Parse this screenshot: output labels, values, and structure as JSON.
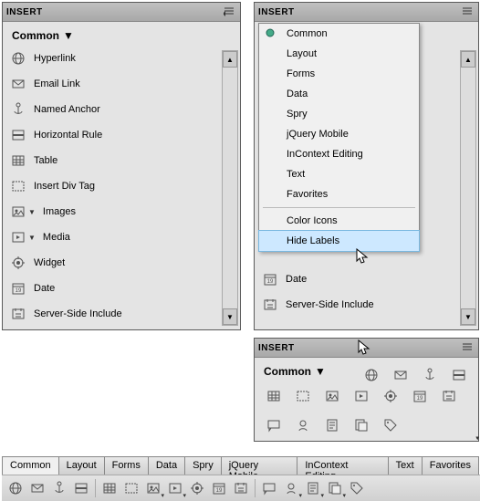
{
  "panel_title": "INSERT",
  "category": "Common",
  "left_panel": {
    "items": [
      {
        "label": "Hyperlink",
        "icon": "hyperlink"
      },
      {
        "label": "Email Link",
        "icon": "email"
      },
      {
        "label": "Named Anchor",
        "icon": "anchor"
      },
      {
        "label": "Horizontal Rule",
        "icon": "hrule"
      },
      {
        "label": "Table",
        "icon": "table"
      },
      {
        "label": "Insert Div Tag",
        "icon": "div"
      },
      {
        "label": "Images",
        "icon": "images",
        "has_sub": true
      },
      {
        "label": "Media",
        "icon": "media",
        "has_sub": true
      },
      {
        "label": "Widget",
        "icon": "widget"
      },
      {
        "label": "Date",
        "icon": "date"
      },
      {
        "label": "Server-Side Include",
        "icon": "ssi"
      }
    ]
  },
  "right_panel": {
    "visible_items": [
      {
        "label": "Date",
        "icon": "date"
      },
      {
        "label": "Server-Side Include",
        "icon": "ssi"
      }
    ]
  },
  "flyout": {
    "groups": [
      [
        "Common",
        "Layout",
        "Forms",
        "Data",
        "Spry",
        "jQuery Mobile",
        "InContext Editing",
        "Text",
        "Favorites"
      ],
      [
        "Color Icons",
        "Hide Labels"
      ]
    ],
    "selected": "Common",
    "hover": "Hide Labels"
  },
  "icon_panel": {
    "row1": [
      "hyperlink",
      "email",
      "anchor",
      "hrule"
    ],
    "row2": [
      "table",
      "div",
      "images",
      "media",
      "widget",
      "date",
      "ssi"
    ],
    "row3": [
      "comment",
      "head",
      "script",
      "templates",
      "tag"
    ]
  },
  "tabs": [
    "Common",
    "Layout",
    "Forms",
    "Data",
    "Spry",
    "jQuery Mobile",
    "InContext Editing",
    "Text",
    "Favorites"
  ],
  "active_tab": "Common",
  "bottom_toolbar": [
    "hyperlink",
    "email",
    "anchor",
    "hrule",
    "table",
    "div",
    "images",
    "media",
    "widget",
    "date",
    "ssi",
    "comment",
    "head",
    "script",
    "templates",
    "tag"
  ]
}
